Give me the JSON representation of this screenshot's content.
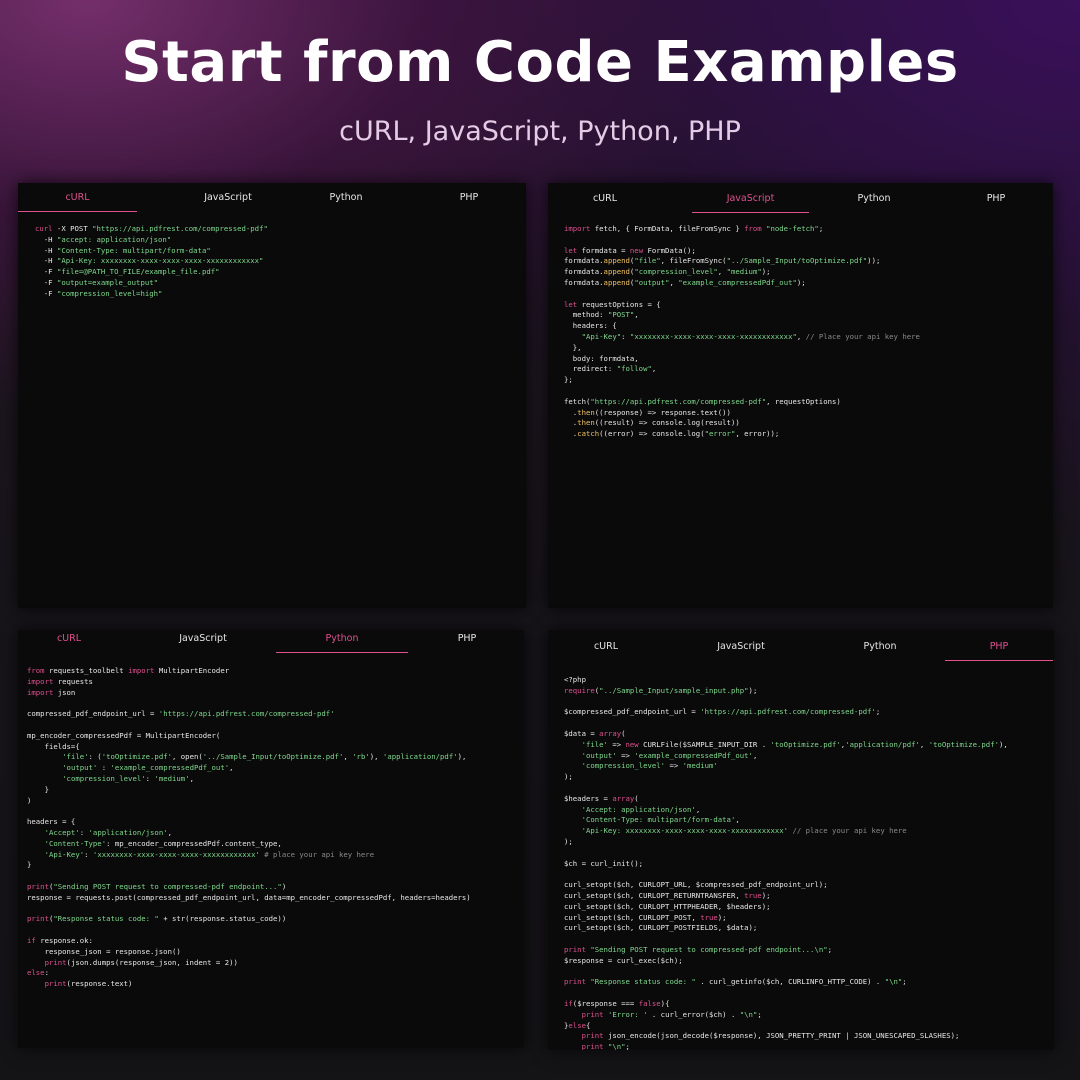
{
  "header": {
    "title": "Start from Code Examples",
    "subtitle": "cURL, JavaScript, Python, PHP"
  },
  "colors": {
    "accent": "#e0508e",
    "string": "#7fd98c",
    "function": "#f0c060",
    "panel_bg": "#0a0a0b"
  },
  "panels": [
    {
      "id": "curl",
      "active_tab": "cURL",
      "tabs": [
        "cURL",
        "JavaScript",
        "Python",
        "PHP"
      ],
      "code": [
        "curl -X POST \"https://api.pdfrest.com/compressed-pdf\"",
        "  -H \"accept: application/json\"",
        "  -H \"Content-Type: multipart/form-data\"",
        "  -H \"Api-Key: xxxxxxxx-xxxx-xxxx-xxxx-xxxxxxxxxxxx\"",
        "  -F \"file=@PATH_TO_FILE/example_file.pdf\"",
        "  -F \"output=example_output\"",
        "  -F \"compression_level=high\""
      ]
    },
    {
      "id": "javascript",
      "active_tab": "JavaScript",
      "tabs": [
        "cURL",
        "JavaScript",
        "Python",
        "PHP"
      ],
      "code": [
        "import fetch, { FormData, fileFromSync } from \"node-fetch\";",
        "",
        "let formdata = new FormData();",
        "formdata.append(\"file\", fileFromSync(\"../Sample_Input/toOptimize.pdf\"));",
        "formdata.append(\"compression_level\", \"medium\");",
        "formdata.append(\"output\", \"example_compressedPdf_out\");",
        "",
        "let requestOptions = {",
        "  method: \"POST\",",
        "  headers: {",
        "    \"Api-Key\": \"xxxxxxxx-xxxx-xxxx-xxxx-xxxxxxxxxxxx\", // Place your api key here",
        "  },",
        "  body: formdata,",
        "  redirect: \"follow\",",
        "};",
        "",
        "fetch(\"https://api.pdfrest.com/compressed-pdf\", requestOptions)",
        "  .then((response) => response.text())",
        "  .then((result) => console.log(result))",
        "  .catch((error) => console.log(\"error\", error));"
      ]
    },
    {
      "id": "python",
      "active_tab": "Python",
      "tabs": [
        "cURL",
        "JavaScript",
        "Python",
        "PHP"
      ],
      "code": [
        "from requests_toolbelt import MultipartEncoder",
        "import requests",
        "import json",
        "",
        "compressed_pdf_endpoint_url = 'https://api.pdfrest.com/compressed-pdf'",
        "",
        "mp_encoder_compressedPdf = MultipartEncoder(",
        "    fields={",
        "        'file': ('toOptimize.pdf', open('../Sample_Input/toOptimize.pdf', 'rb'), 'application/pdf'),",
        "        'output' : 'example_compressedPdf_out',",
        "        'compression_level': 'medium',",
        "    }",
        ")",
        "",
        "headers = {",
        "    'Accept': 'application/json',",
        "    'Content-Type': mp_encoder_compressedPdf.content_type,",
        "    'Api-Key': 'xxxxxxxx-xxxx-xxxx-xxxx-xxxxxxxxxxxx' # place your api key here",
        "}",
        "",
        "print(\"Sending POST request to compressed-pdf endpoint...\")",
        "response = requests.post(compressed_pdf_endpoint_url, data=mp_encoder_compressedPdf, headers=headers)",
        "",
        "print(\"Response status code: \" + str(response.status_code))",
        "",
        "if response.ok:",
        "    response_json = response.json()",
        "    print(json.dumps(response_json, indent = 2))",
        "else:",
        "    print(response.text)"
      ]
    },
    {
      "id": "php",
      "active_tab": "PHP",
      "tabs": [
        "cURL",
        "JavaScript",
        "Python",
        "PHP"
      ],
      "code": [
        "<?php",
        "require(\"../Sample_Input/sample_input.php\");",
        "",
        "$compressed_pdf_endpoint_url = 'https://api.pdfrest.com/compressed-pdf';",
        "",
        "$data = array(",
        "    'file' => new CURLFile($SAMPLE_INPUT_DIR . 'toOptimize.pdf','application/pdf', 'toOptimize.pdf'),",
        "    'output' => 'example_compressedPdf_out',",
        "    'compression_level' => 'medium'",
        ");",
        "",
        "$headers = array(",
        "    'Accept: application/json',",
        "    'Content-Type: multipart/form-data',",
        "    'Api-Key: xxxxxxxx-xxxx-xxxx-xxxx-xxxxxxxxxxxx' // place your api key here",
        ");",
        "",
        "$ch = curl_init();",
        "",
        "curl_setopt($ch, CURLOPT_URL, $compressed_pdf_endpoint_url);",
        "curl_setopt($ch, CURLOPT_RETURNTRANSFER, true);",
        "curl_setopt($ch, CURLOPT_HTTPHEADER, $headers);",
        "curl_setopt($ch, CURLOPT_POST, true);",
        "curl_setopt($ch, CURLOPT_POSTFIELDS, $data);",
        "",
        "print \"Sending POST request to compressed-pdf endpoint...\\n\";",
        "$response = curl_exec($ch);",
        "",
        "print \"Response status code: \" . curl_getinfo($ch, CURLINFO_HTTP_CODE) . \"\\n\";",
        "",
        "if($response === false){",
        "    print 'Error: ' . curl_error($ch) . \"\\n\";",
        "}else{",
        "    print json_encode(json_decode($response), JSON_PRETTY_PRINT | JSON_UNESCAPED_SLASHES);",
        "    print \"\\n\";"
      ]
    }
  ]
}
